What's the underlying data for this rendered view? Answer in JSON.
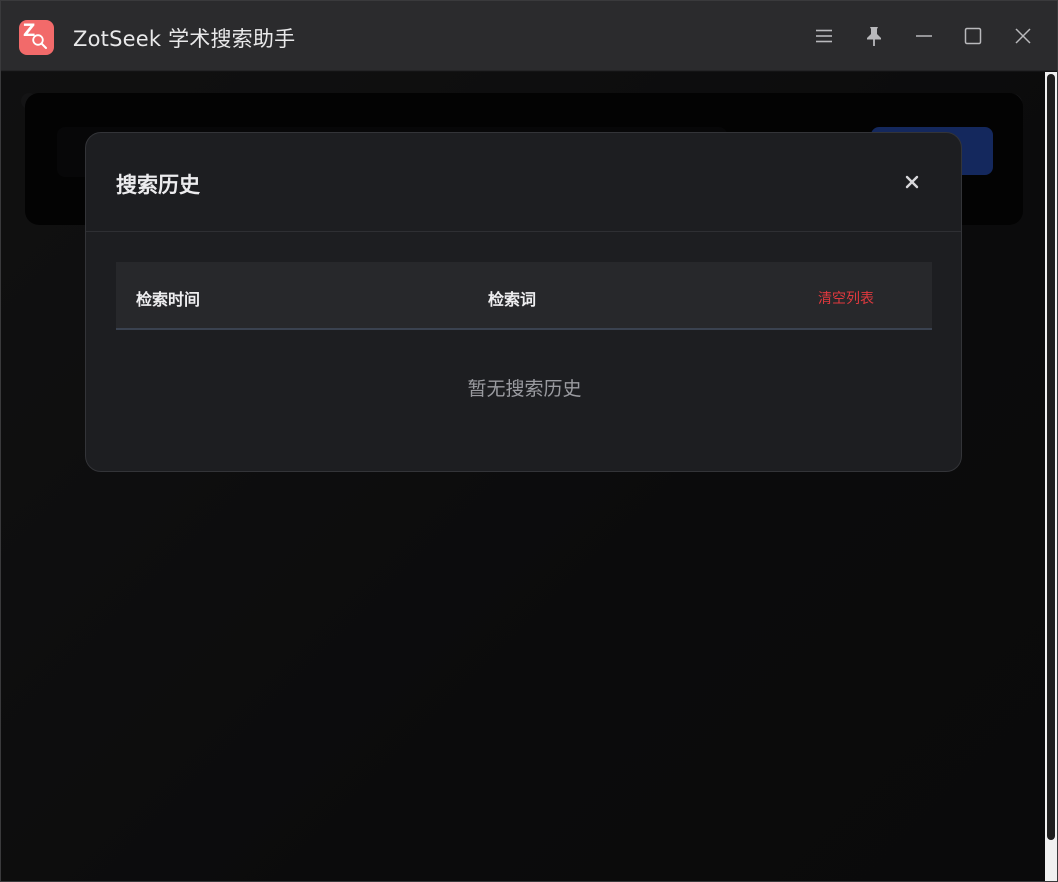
{
  "app": {
    "title": "ZotSeek 学术搜索助手",
    "logo_letter": "Z"
  },
  "dialog": {
    "title": "搜索历史",
    "close_symbol": "×"
  },
  "table": {
    "columns": {
      "time": "检索时间",
      "term": "检索词"
    },
    "clear_label": "清空列表",
    "empty_text": "暂无搜索历史"
  },
  "colors": {
    "titlebar": "#2b2b2d",
    "dialog_bg": "#1d1e21",
    "accent_red": "#e0393e",
    "logo_bg": "#f26a6a",
    "primary_blue": "#1f3e8f"
  },
  "icons": [
    "menu-icon",
    "pin-icon",
    "minimize-icon",
    "maximize-icon",
    "close-icon",
    "magnifier-icon"
  ]
}
